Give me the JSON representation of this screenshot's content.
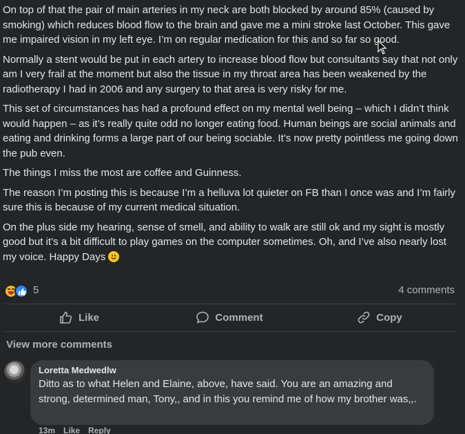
{
  "post": {
    "paragraphs": [
      "On top of that the pair of main arteries in my neck are both blocked by around 85% (caused by smoking) which reduces blood flow to the brain and gave me a mini stroke last October. This gave me impaired vision in my left eye. I’m on regular medication for this and so far so good.",
      "Normally a stent would be put in each artery to increase blood flow but consultants say that not only am I very frail at the moment but also the tissue in my throat area has been weakened by the radiotherapy I had in 2006 and any surgery to that area is very risky for me.",
      "This set of circumstances has had a profound effect on my mental well being – which I didn’t think would happen – as it’s really quite odd no longer eating food. Human beings are social animals and eating and drinking forms a large part of our being sociable. It’s now pretty pointless me going down the pub even.",
      "The things I miss the most are coffee and Guinness.",
      "The reason I’m posting this is because I’m a helluva lot quieter on FB than I once was and I’m fairly sure this is because of my current medical situation.",
      "On the plus side my hearing, sense of smell, and ability to walk are still ok and my sight is mostly good but it’s a bit difficult to play games on the computer sometimes. Oh, and I’ve also nearly lost my voice. Happy Days"
    ],
    "last_emoji": "smile-emoji"
  },
  "stats": {
    "reactions": [
      "haha-reaction-icon",
      "like-reaction-icon"
    ],
    "reaction_count": "5",
    "comment_count": "4 comments"
  },
  "actions": {
    "like": "Like",
    "comment": "Comment",
    "copy": "Copy"
  },
  "view_more": "View more comments",
  "comment": {
    "author": "Loretta Medwedlw",
    "text": "Ditto as to what Helen and Elaine, above, have said. You are an amazing and strong, determined man, Tony,, and in this you remind me of how my brother was,,.",
    "time": "13m",
    "like": "Like",
    "reply": "Reply"
  },
  "colors": {
    "background": "#242526",
    "bubble": "#3a3b3c",
    "text": "#e4e6eb",
    "secondary_text": "#b0b3b8",
    "like_blue": "#2d88ff"
  }
}
